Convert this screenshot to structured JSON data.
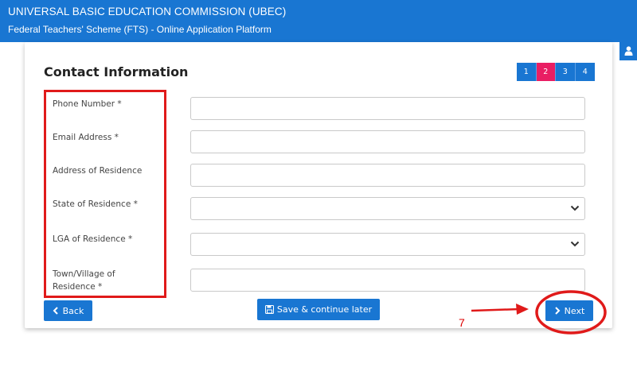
{
  "header": {
    "title": "UNIVERSAL BASIC EDUCATION COMMISSION (UBEC)",
    "subtitle": "Federal Teachers' Scheme (FTS) - Online Application Platform"
  },
  "form": {
    "title": "Contact Information",
    "steps": [
      "1",
      "2",
      "3",
      "4"
    ],
    "active_step": "2",
    "fields": [
      {
        "label": "Phone Number  *",
        "value": ""
      },
      {
        "label": "Email Address  *",
        "value": ""
      },
      {
        "label": "Address of Residence",
        "value": ""
      },
      {
        "label": "State of Residence  *",
        "value": ""
      },
      {
        "label": "LGA of Residence  *",
        "value": ""
      },
      {
        "label": "Town/Village of Residence  *",
        "value": ""
      }
    ]
  },
  "buttons": {
    "back": "Back",
    "save": "Save & continue later",
    "next": "Next"
  },
  "annotation": {
    "number": "7",
    "color": "#e01a1a"
  },
  "colors": {
    "primary": "#1976d2",
    "active_step": "#e91e63"
  }
}
